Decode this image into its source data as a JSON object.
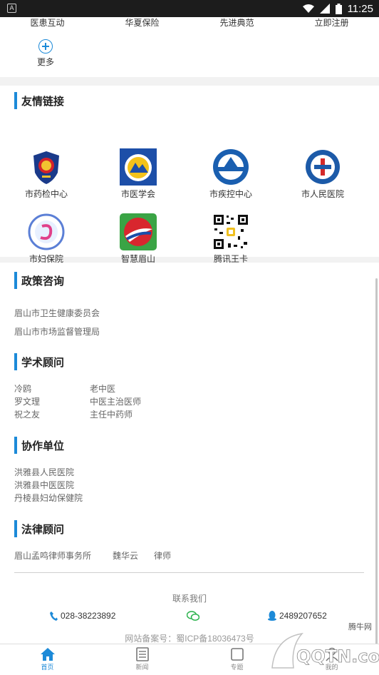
{
  "status_bar": {
    "time": "11:25"
  },
  "top_nav": {
    "items": [
      "医患互动",
      "华夏保险",
      "先进典范",
      "立即注册"
    ],
    "more_label": "更多"
  },
  "friend_links": {
    "title": "友情链接",
    "items": [
      {
        "name": "市药检中心",
        "icon": "police-emblem-icon"
      },
      {
        "name": "市医学会",
        "icon": "medical-association-icon"
      },
      {
        "name": "市疾控中心",
        "icon": "cdc-icon"
      },
      {
        "name": "市人民医院",
        "icon": "hospital-icon"
      },
      {
        "name": "市妇保院",
        "icon": "maternity-hospital-icon"
      },
      {
        "name": "智慧眉山",
        "icon": "smart-meishan-icon"
      },
      {
        "name": "腾讯王卡",
        "icon": "qr-code-icon"
      }
    ]
  },
  "policy": {
    "title": "政策咨询",
    "items": [
      "眉山市卫生健康委员会",
      "眉山市市场监督管理局"
    ]
  },
  "academic": {
    "title": "学术顾问",
    "rows": [
      [
        "冷鸥",
        "老中医"
      ],
      [
        "罗文理",
        "中医主治医师"
      ],
      [
        "祝之友",
        "主任中药师"
      ]
    ]
  },
  "cooperation": {
    "title": "协作单位",
    "items": [
      "洪雅县人民医院",
      "洪雅县中医医院",
      "丹棱县妇幼保健院"
    ]
  },
  "legal": {
    "title": "法律顾问",
    "firm": "眉山孟鸣律师事务所",
    "person": "魏华云",
    "role": "律师"
  },
  "contact": {
    "title": "联系我们",
    "phone": "028-38223892",
    "qq": "2489207652"
  },
  "record_text": "网站备案号：蜀ICP备18036473号",
  "tabs": [
    {
      "label": "首页",
      "active": true
    },
    {
      "label": "新闻",
      "active": false
    },
    {
      "label": "专题",
      "active": false
    },
    {
      "label": "我的",
      "active": false
    }
  ],
  "watermark": {
    "text": "腾牛网",
    "logo_text": "QQTN.com"
  },
  "colors": {
    "accent": "#1c8ad8",
    "statusbar": "#1c1c1c"
  }
}
